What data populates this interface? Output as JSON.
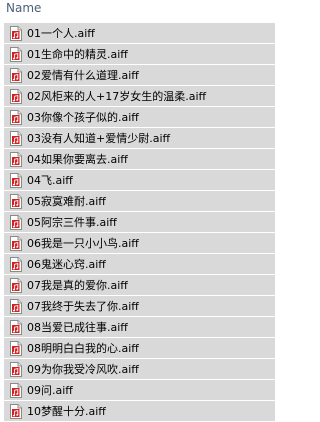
{
  "header": {
    "column_name": "Name"
  },
  "colors": {
    "row_background": "#d9d9d9",
    "header_text": "#4c607a",
    "icon_accent": "#d21f1f"
  },
  "file_icon": "audio-file-icon",
  "files": [
    {
      "name": "01一个人.aiff"
    },
    {
      "name": "01生命中的精灵.aiff"
    },
    {
      "name": "02爱情有什么道理.aiff"
    },
    {
      "name": "02风柜来的人+17岁女生的温柔.aiff"
    },
    {
      "name": "03你像个孩子似的.aiff"
    },
    {
      "name": "03没有人知道+爱情少尉.aiff"
    },
    {
      "name": "04如果你要离去.aiff"
    },
    {
      "name": "04飞.aiff"
    },
    {
      "name": "05寂寞难耐.aiff"
    },
    {
      "name": "05阿宗三件事.aiff"
    },
    {
      "name": "06我是一只小小鸟.aiff"
    },
    {
      "name": "06鬼迷心窍.aiff"
    },
    {
      "name": "07我是真的爱你.aiff"
    },
    {
      "name": "07我终于失去了你.aiff"
    },
    {
      "name": "08当爱已成往事.aiff"
    },
    {
      "name": "08明明白白我的心.aiff"
    },
    {
      "name": "09为你我受冷风吹.aiff"
    },
    {
      "name": "09问.aiff"
    },
    {
      "name": "10梦醒十分.aiff"
    }
  ]
}
